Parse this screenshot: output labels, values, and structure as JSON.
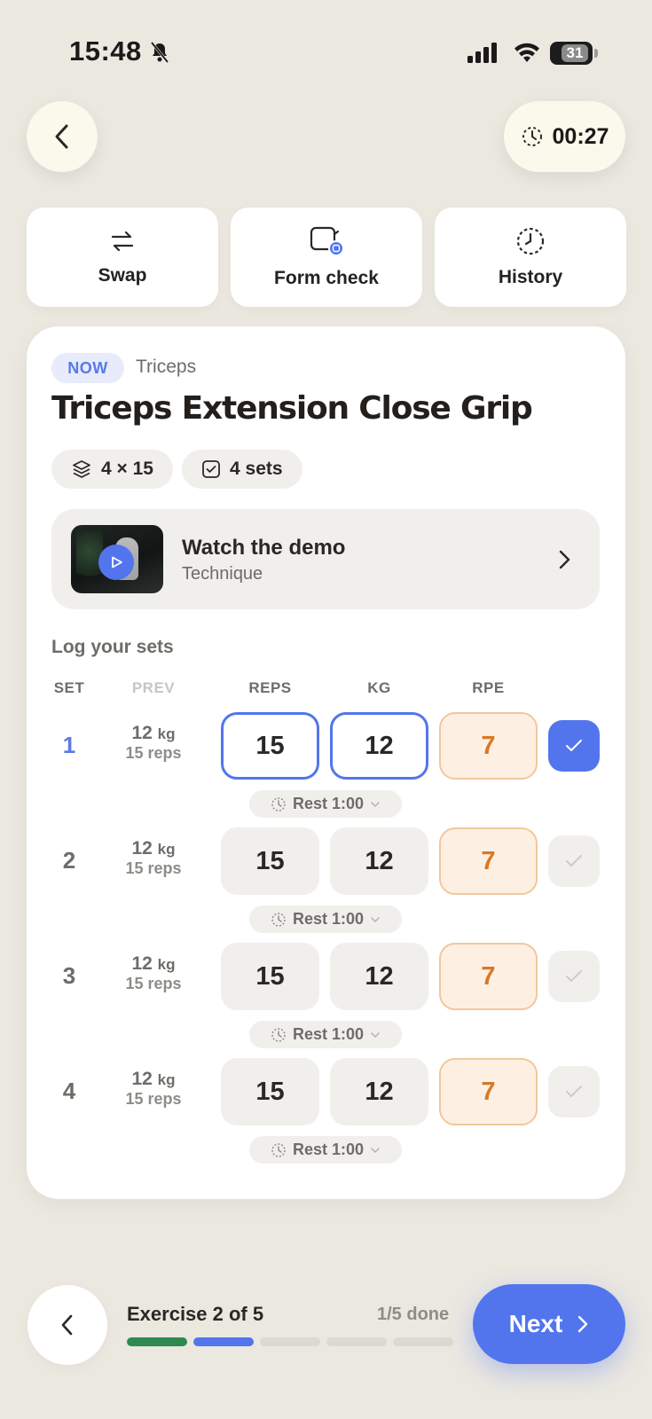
{
  "status_bar": {
    "time": "15:48",
    "battery": "31"
  },
  "header": {
    "timer": "00:27"
  },
  "actions": [
    {
      "label": "Swap",
      "icon": "swap-arrows-icon"
    },
    {
      "label": "Form check",
      "icon": "camera-icon"
    },
    {
      "label": "History",
      "icon": "history-clock-icon"
    }
  ],
  "exercise": {
    "badge": "NOW",
    "muscle": "Triceps",
    "title": "Triceps Extension Close Grip",
    "chips": [
      {
        "label": "4 × 15",
        "icon": "layers-icon"
      },
      {
        "label": "4 sets",
        "icon": "checkbox-icon"
      }
    ],
    "demo": {
      "title": "Watch the demo",
      "subtitle": "Technique"
    }
  },
  "log": {
    "title": "Log your sets",
    "columns": {
      "set": "SET",
      "prev": "PREV",
      "reps": "REPS",
      "kg": "KG",
      "rpe": "RPE"
    },
    "sets": [
      {
        "num": "1",
        "prev_kg": "12",
        "prev_unit": "kg",
        "prev_reps": "15 reps",
        "reps": "15",
        "kg": "12",
        "rpe": "7",
        "done": true,
        "rest": "Rest 1:00"
      },
      {
        "num": "2",
        "prev_kg": "12",
        "prev_unit": "kg",
        "prev_reps": "15 reps",
        "reps": "15",
        "kg": "12",
        "rpe": "7",
        "done": false,
        "rest": "Rest 1:00"
      },
      {
        "num": "3",
        "prev_kg": "12",
        "prev_unit": "kg",
        "prev_reps": "15 reps",
        "reps": "15",
        "kg": "12",
        "rpe": "7",
        "done": false,
        "rest": "Rest 1:00"
      },
      {
        "num": "4",
        "prev_kg": "12",
        "prev_unit": "kg",
        "prev_reps": "15 reps",
        "reps": "15",
        "kg": "12",
        "rpe": "7",
        "done": false,
        "rest": "Rest 1:00"
      }
    ]
  },
  "footer": {
    "progress_label": "Exercise 2 of 5",
    "done_label": "1/5 done",
    "next_label": "Next",
    "segments": [
      "complete",
      "current",
      "pending",
      "pending",
      "pending"
    ]
  },
  "colors": {
    "accent": "#5275ee",
    "complete": "#2f8a52",
    "rpe": "#d97826",
    "background": "#ebe8e0"
  }
}
